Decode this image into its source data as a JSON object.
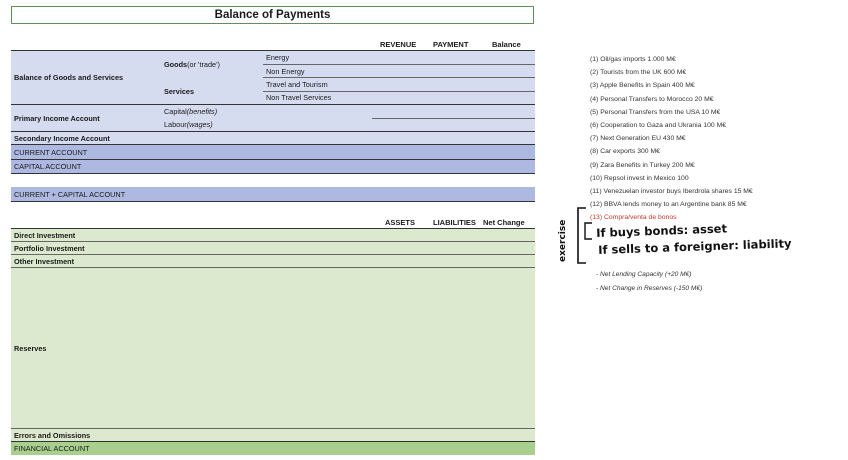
{
  "title": "Balance of Payments",
  "current_headers": {
    "revenue": "REVENUE",
    "payment": "PAYMENT",
    "balance": "Balance"
  },
  "bogs": {
    "label": "Balance of Goods and Services",
    "goods": {
      "prefix": "Goods ",
      "suffix": "(or 'trade')"
    },
    "energy": "Energy",
    "non_energy": "Non Energy",
    "services": "Services",
    "travel": "Travel and Tourism",
    "non_travel": "Non Travel Services"
  },
  "primary": {
    "label": "Primary Income Account",
    "capital": {
      "prefix": "Capital ",
      "suffix": "(benefits)"
    },
    "labour": {
      "prefix": "Labour ",
      "suffix": "(wages)"
    }
  },
  "secondary": "Secondary Income Account",
  "current_account": "CURRENT ACCOUNT",
  "capital_account": "CAPITAL ACCOUNT",
  "current_capital": "CURRENT + CAPITAL ACCOUNT",
  "financial_headers": {
    "assets": "ASSETS",
    "liabilities": "LIABILITIES",
    "net_change": "Net Change"
  },
  "financial": {
    "direct": "Direct Investment",
    "portfolio": "Portfolio Investment",
    "other": "Other Investment",
    "reserves": "Reserves",
    "errors": "Errors and Omissions",
    "financial_account": "FINANCIAL ACCOUNT"
  },
  "notes": [
    "(1) Oil/gas imports 1.000 M€",
    "(2) Tourists from the UK 600 M€",
    "(3) Apple Benefits in Spain 400 M€",
    "(4) Personal Transfers to Morocco 20 M€",
    "(5) Personal Transfers from the USA 10 M€",
    "(6) Cooperation to Gaza and Ukrania 100 M€",
    "(7) Next Generation EU 430 M€",
    "(8) Car exports 300 M€",
    "(9) Zara Benefits in Turkey 200 M€",
    "(10) Repsol invest in Mexico 100",
    "(11) Venezuelan investor buys Iberdrola shares 15 M€",
    "(12) BBVA lends money to an Argentine bank 85 M€"
  ],
  "note_13": "(13) Compra/venta de bonos",
  "handwriting": {
    "side": "exercise",
    "line1": "If buys bonds: asset",
    "line2": "If sells to a foreigner: liability"
  },
  "summary": [
    "- Net Lending Capacity (+20 M€)",
    "- Net Change in Reserves (-150 M€)"
  ],
  "colors": {
    "blue": "#d6dcf0",
    "dark_blue": "#aeb9e2",
    "green": "#dde9cf",
    "dark_green": "#a9cf8e",
    "note_red": "#c0392b"
  }
}
